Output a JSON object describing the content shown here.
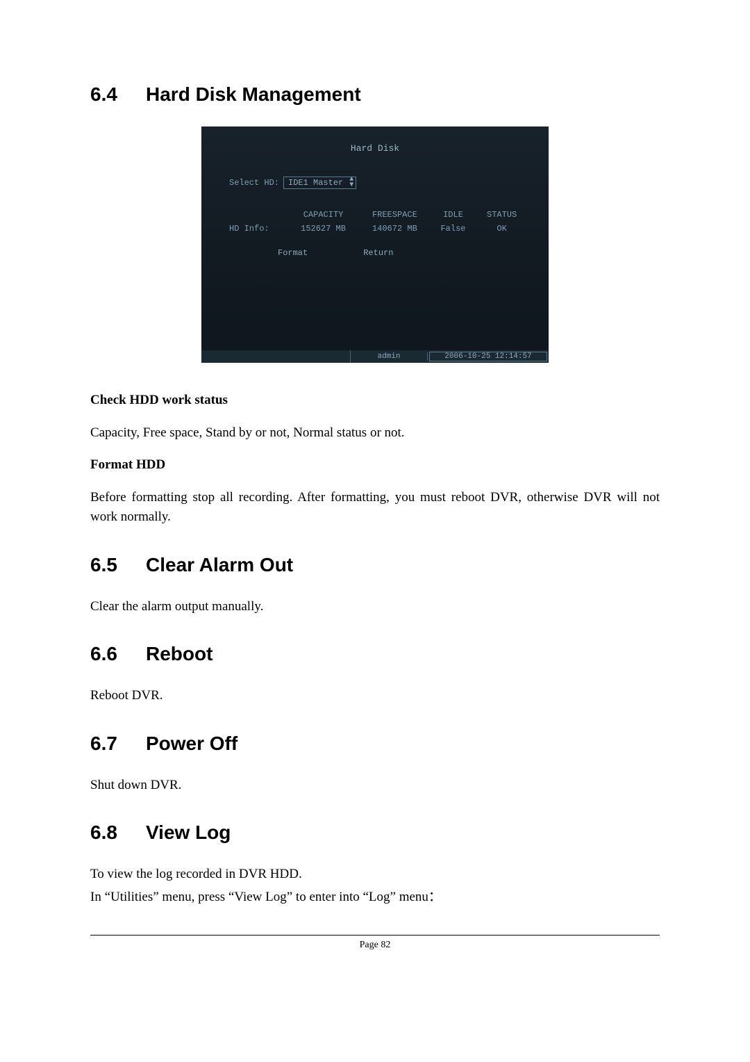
{
  "sections": {
    "s64": {
      "num": "6.4",
      "title": "Hard Disk Management"
    },
    "s65": {
      "num": "6.5",
      "title": "Clear Alarm Out"
    },
    "s66": {
      "num": "6.6",
      "title": "Reboot"
    },
    "s67": {
      "num": "6.7",
      "title": "Power Off"
    },
    "s68": {
      "num": "6.8",
      "title": "View Log"
    }
  },
  "dvr": {
    "title": "Hard Disk",
    "select_label": "Select HD:",
    "select_value": "IDE1 Master",
    "headers": {
      "c0": "",
      "c1": "CAPACITY",
      "c2": "FREESPACE",
      "c3": "IDLE",
      "c4": "STATUS"
    },
    "row": {
      "c0": "HD Info:",
      "c1": "152627 MB",
      "c2": "140672 MB",
      "c3": "False",
      "c4": "OK"
    },
    "btn_format": "Format",
    "btn_return": "Return",
    "status_user": "admin",
    "status_time": "2006-10-25 12:14:57"
  },
  "text": {
    "check_hdd_heading": "Check HDD work status",
    "check_hdd_body": "Capacity, Free space, Stand by or not, Normal status or not.",
    "format_hdd_heading": "Format HDD",
    "format_hdd_body": "Before formatting stop all recording. After formatting, you must reboot DVR, otherwise DVR will not work normally.",
    "clear_alarm_body": "Clear the alarm output manually.",
    "reboot_body": "Reboot DVR.",
    "poweroff_body": "Shut down DVR.",
    "viewlog_body1": "To view the log recorded in DVR HDD.",
    "viewlog_body2": "In “Utilities” menu, press “View Log” to enter into “Log” menu："
  },
  "footer": {
    "page_label": "Page 82"
  }
}
